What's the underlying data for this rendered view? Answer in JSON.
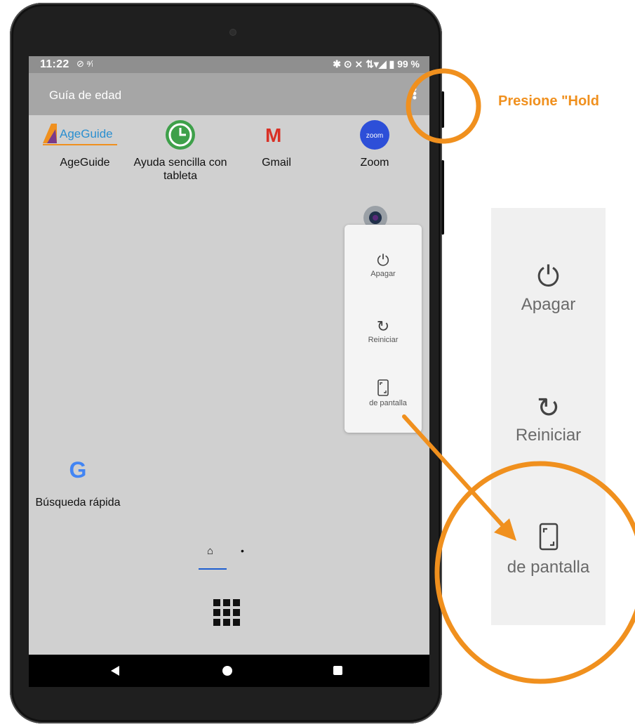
{
  "status_bar": {
    "time": "11:22",
    "left_icons": "⊘ ᵃ⁄ₗ",
    "right_icons": "✱ ⊙ ⨯ ⇅▾◢ ▮",
    "battery": "99 %"
  },
  "app_bar": {
    "title": "Guía de edad"
  },
  "apps": [
    {
      "label": "AgeGuide",
      "icon": "ageguide-logo",
      "logo_text": "AgeGuide"
    },
    {
      "label": "Ayuda sencilla con tableta",
      "icon": "clock-app-icon"
    },
    {
      "label": "Gmail",
      "icon": "gmail-icon",
      "logo_text": "M"
    },
    {
      "label": "Zoom",
      "icon": "zoom-icon",
      "logo_text": "zoom"
    },
    {
      "label": "Búsqueda rápida",
      "icon": "google-icon",
      "logo_text": "G"
    }
  ],
  "power_menu": {
    "items": [
      {
        "label": "Apagar",
        "icon": "power-icon"
      },
      {
        "label": "Reiniciar",
        "icon": "restart-icon"
      },
      {
        "label": "de pantalla",
        "icon": "screenshot-icon"
      }
    ]
  },
  "pager": {
    "pages": 2,
    "current": 1
  },
  "navigation": {
    "back": "back",
    "home": "home",
    "recents": "recents"
  },
  "annotation": {
    "callout": "Presione \"Hold",
    "color": "#f0901e"
  },
  "zoomed_menu": {
    "items": [
      {
        "label": "Apagar",
        "icon": "power-icon"
      },
      {
        "label": "Reiniciar",
        "icon": "restart-icon"
      },
      {
        "label": "de pantalla",
        "icon": "screenshot-icon"
      }
    ]
  }
}
